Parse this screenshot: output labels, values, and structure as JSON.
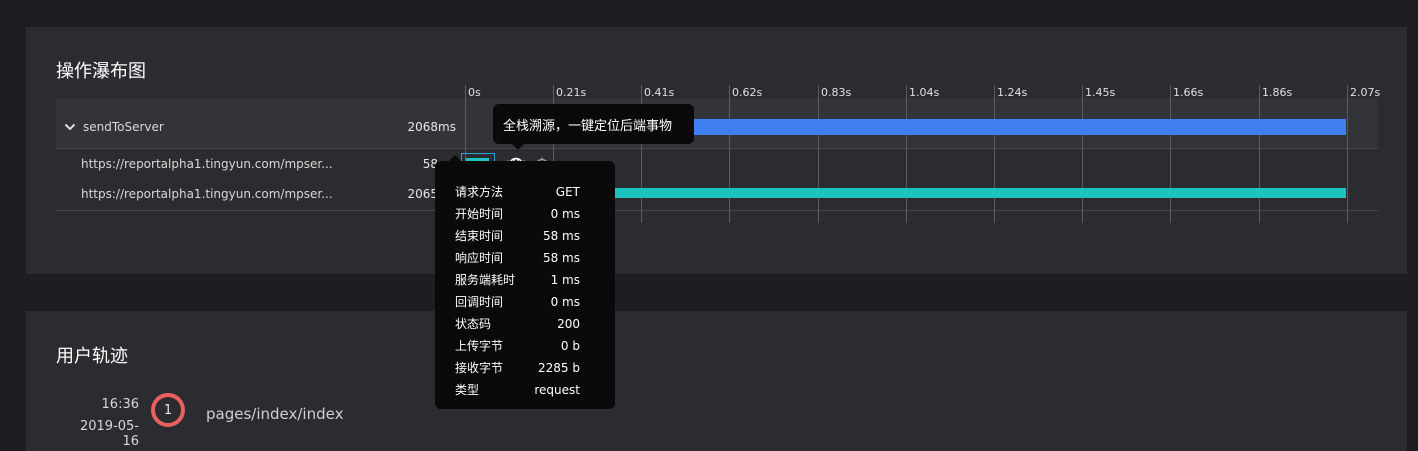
{
  "waterfall": {
    "title": "操作瀑布图",
    "ticks": [
      "0s",
      "0.21s",
      "0.41s",
      "0.62s",
      "0.83s",
      "1.04s",
      "1.24s",
      "1.45s",
      "1.66s",
      "1.86s",
      "2.07s"
    ],
    "rows": [
      {
        "name": "sendToServer",
        "duration": "2068ms",
        "expanded": true
      },
      {
        "name": "https://reportalpha1.tingyun.com/mpser...",
        "duration": "58ms"
      },
      {
        "name": "https://reportalpha1.tingyun.com/mpser...",
        "duration": "2065ms"
      }
    ],
    "colors": {
      "primary_bar": "#3f7fef",
      "request_bar": "#1fc3bd",
      "selection": "#2aa3d8"
    }
  },
  "tooltip_action": {
    "text": "全栈溯源，一键定位后端事物"
  },
  "detail_tooltip": {
    "items": [
      {
        "key": "请求方法",
        "value": "GET"
      },
      {
        "key": "开始时间",
        "value": "0 ms"
      },
      {
        "key": "结束时间",
        "value": "58 ms"
      },
      {
        "key": "响应时间",
        "value": "58 ms"
      },
      {
        "key": "服务端耗时",
        "value": "1 ms"
      },
      {
        "key": "回调时间",
        "value": "0 ms"
      },
      {
        "key": "状态码",
        "value": "200"
      },
      {
        "key": "上传字节",
        "value": "0 b"
      },
      {
        "key": "接收字节",
        "value": "2285 b"
      },
      {
        "key": "类型",
        "value": "request"
      }
    ]
  },
  "track": {
    "title": "用户轨迹",
    "steps": [
      {
        "time": "16:36",
        "date": "2019-05-16",
        "index": "1",
        "path": "pages/index/index"
      }
    ],
    "colors": {
      "step_ring": "#e9605f"
    }
  }
}
